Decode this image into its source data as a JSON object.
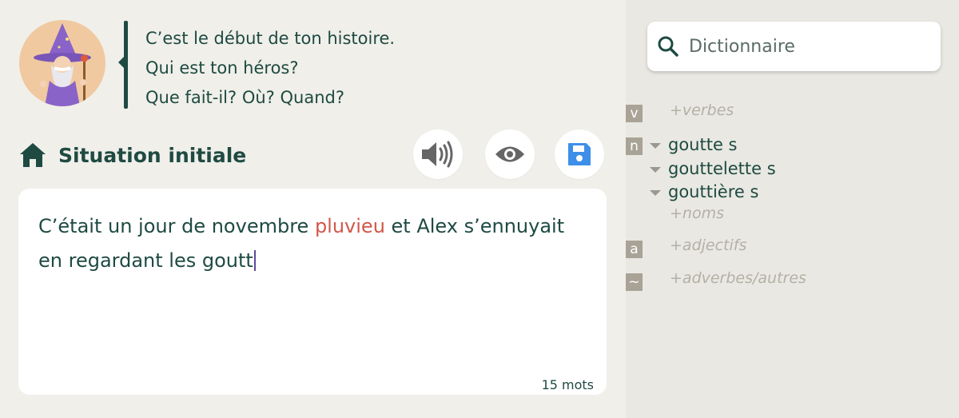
{
  "prompt": {
    "lines": [
      "C’est le début de ton histoire.",
      "Qui est ton héros?",
      "Que fait-il? Où? Quand?"
    ]
  },
  "section": {
    "title": "Situation initiale",
    "icon": "home-icon"
  },
  "toolbar": {
    "speaker_icon": "speaker-icon",
    "eye_icon": "eye-icon",
    "save_icon": "save-icon"
  },
  "editor": {
    "text_before": "C’était un jour de novembre ",
    "misspelled_word": "pluvieu",
    "text_after": " et Alex s’ennuyait en regardant les goutt",
    "word_count": "15 mots"
  },
  "dictionary": {
    "placeholder": "Dictionnaire",
    "categories": {
      "verbs": {
        "badge": "v",
        "label": "+verbes"
      },
      "nouns": {
        "badge": "n",
        "words": [
          "goutte s",
          "gouttelette s",
          "gouttière s"
        ],
        "more_label": "+noms"
      },
      "adjectives": {
        "badge": "a",
        "label": "+adjectifs"
      },
      "adverbs": {
        "badge": "~",
        "label": "+adverbes/autres"
      }
    }
  },
  "colors": {
    "primary": "#1e4a42",
    "error": "#d2574a",
    "save": "#3d8fe8",
    "badge": "#a8a396"
  }
}
